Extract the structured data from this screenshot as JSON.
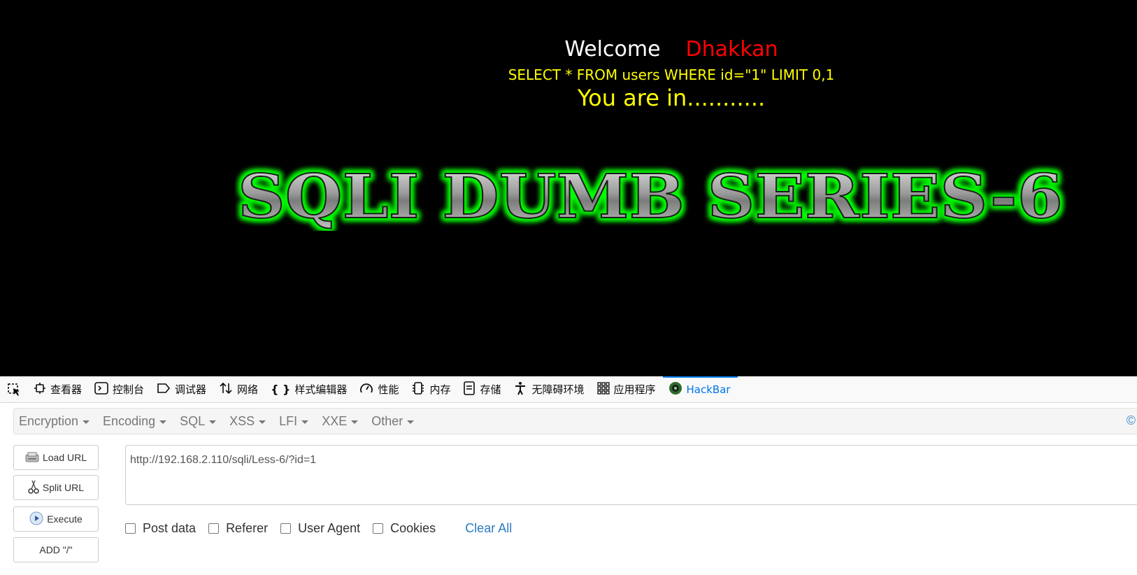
{
  "page": {
    "welcome_word": "Welcome",
    "user_name": "Dhakkan",
    "query": "SELECT * FROM users WHERE id=\"1\" LIMIT 0,1",
    "status": "You are in...........",
    "banner": "SQLI DUMB SERIES-6"
  },
  "devtools": {
    "tabs": [
      {
        "label": "查看器",
        "icon": "inspector-icon"
      },
      {
        "label": "控制台",
        "icon": "console-icon"
      },
      {
        "label": "调试器",
        "icon": "debugger-icon"
      },
      {
        "label": "网络",
        "icon": "network-icon"
      },
      {
        "label": "样式编辑器",
        "icon": "style-editor-icon"
      },
      {
        "label": "性能",
        "icon": "performance-icon"
      },
      {
        "label": "内存",
        "icon": "memory-icon"
      },
      {
        "label": "存储",
        "icon": "storage-icon"
      },
      {
        "label": "无障碍环境",
        "icon": "accessibility-icon"
      },
      {
        "label": "应用程序",
        "icon": "application-icon"
      },
      {
        "label": "HackBar",
        "icon": "hackbar-icon",
        "active": true
      }
    ]
  },
  "hackbar": {
    "menu": [
      "Encryption",
      "Encoding",
      "SQL",
      "XSS",
      "LFI",
      "XXE",
      "Other"
    ],
    "right_mark": "©",
    "buttons": {
      "load": "Load URL",
      "split": "Split URL",
      "execute": "Execute",
      "add": "ADD \"/\""
    },
    "url_value": "http://192.168.2.110/sqli/Less-6/?id=1",
    "options": {
      "post_data": "Post data",
      "referer": "Referer",
      "user_agent": "User Agent",
      "cookies": "Cookies",
      "clear_all": "Clear All"
    }
  },
  "colors": {
    "welcome": "#ffffff",
    "user": "#ff0000",
    "query": "#ffff00",
    "banner_glow": "#00ff00",
    "active_tab": "#0074e8"
  }
}
